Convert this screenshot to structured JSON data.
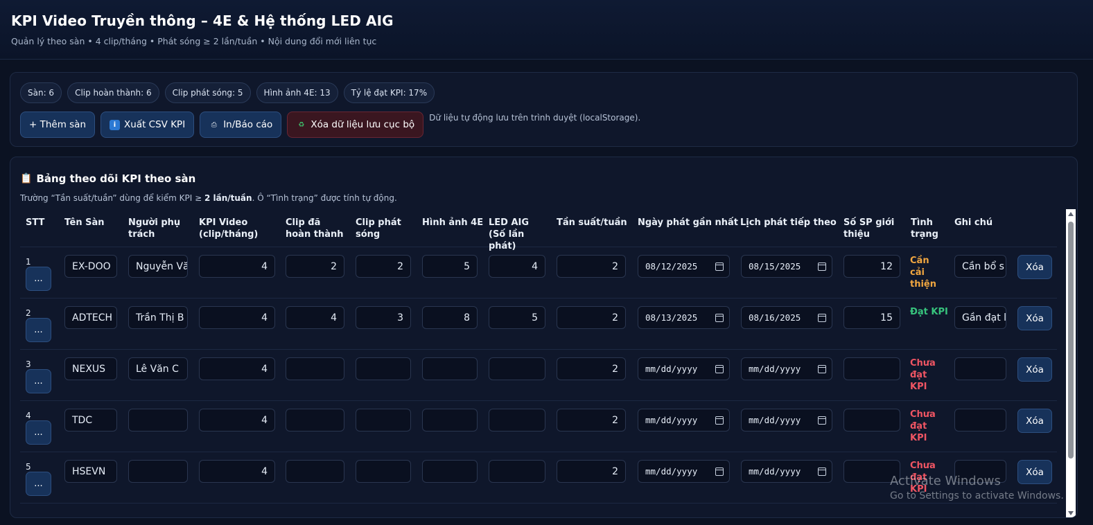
{
  "header": {
    "title": "KPI Video Truyền thông – 4E & Hệ thống LED AIG",
    "subtitle": "Quản lý theo sàn • 4 clip/tháng • Phát sóng ≥ 2 lần/tuần • Nội dung đổi mới liên tục"
  },
  "stats": {
    "chips": [
      "Sàn: 6",
      "Clip hoàn thành: 6",
      "Clip phát sóng: 5",
      "Hình ảnh 4E: 13",
      "Tỷ lệ đạt KPI: 17%"
    ]
  },
  "actions": {
    "add_label": "+ Thêm sàn",
    "export_label": "Xuất CSV KPI",
    "export_icon": "info-icon",
    "print_label": "In/Báo cáo",
    "print_icon": "printer-icon",
    "clear_label": "Xóa dữ liệu lưu cục bộ",
    "clear_icon": "recycle-icon",
    "note": "Dữ liệu tự động lưu trên trình duyệt (localStorage)."
  },
  "table": {
    "title": "Bảng theo dõi KPI theo sàn",
    "title_icon": "clipboard-icon",
    "desc_prefix": "Trường “Tần suất/tuần” dùng để kiểm KPI ≥ ",
    "desc_bold": "2 lần/tuần",
    "desc_suffix": ". Ô “Tình trạng” được tính tự động.",
    "headers": {
      "stt": "STT",
      "ten_san": "Tên Sàn",
      "nguoi_phu_trach": "Người phụ trách",
      "kpi_video": "KPI Video (clip/tháng)",
      "clip_hoan_thanh": "Clip đã hoàn thành",
      "clip_phat_song": "Clip phát sóng",
      "hinh_anh_4e": "Hình ảnh 4E",
      "led_aig": "LED AIG (Số lần phát)",
      "tan_suat": "Tần suất/tuần",
      "ngay_phat": "Ngày phát gần nhất",
      "lich_phat": "Lịch phát tiếp theo",
      "so_sp": "Số SP giới thiệu",
      "tinh_trang": "Tình trạng",
      "ghi_chu": "Ghi chú"
    },
    "menu_label": "...",
    "delete_label": "Xóa",
    "date_placeholder": "mm/dd/yyyy",
    "rows": [
      {
        "stt": "1",
        "ten_san": "EX-DOO",
        "nguoi": "Nguyễn Vă",
        "kpi": "4",
        "hoan_thanh": "2",
        "phat_song": "2",
        "hinh_anh": "5",
        "led": "4",
        "tan_suat": "2",
        "ngay_phat": "08/12/2025",
        "lich_phat": "08/15/2025",
        "so_sp": "12",
        "tinh_trang": "Cần cải thiện",
        "status": "warn",
        "ghi_chu": "Cần bổ s"
      },
      {
        "stt": "2",
        "ten_san": "ADTECH",
        "nguoi": "Trần Thị B",
        "kpi": "4",
        "hoan_thanh": "4",
        "phat_song": "3",
        "hinh_anh": "8",
        "led": "5",
        "tan_suat": "2",
        "ngay_phat": "08/13/2025",
        "lich_phat": "08/16/2025",
        "so_sp": "15",
        "tinh_trang": "Đạt KPI",
        "status": "ok",
        "ghi_chu": "Gần đạt l"
      },
      {
        "stt": "3",
        "ten_san": "NEXUS",
        "nguoi": "Lê Văn C",
        "kpi": "4",
        "hoan_thanh": "",
        "phat_song": "",
        "hinh_anh": "",
        "led": "",
        "tan_suat": "2",
        "ngay_phat": "",
        "lich_phat": "",
        "so_sp": "",
        "tinh_trang": "Chưa đạt KPI",
        "status": "bad",
        "ghi_chu": ""
      },
      {
        "stt": "4",
        "ten_san": "TDC",
        "nguoi": "",
        "kpi": "4",
        "hoan_thanh": "",
        "phat_song": "",
        "hinh_anh": "",
        "led": "",
        "tan_suat": "2",
        "ngay_phat": "",
        "lich_phat": "",
        "so_sp": "",
        "tinh_trang": "Chưa đạt KPI",
        "status": "bad",
        "ghi_chu": ""
      },
      {
        "stt": "5",
        "ten_san": "HSEVN",
        "nguoi": "",
        "kpi": "4",
        "hoan_thanh": "",
        "phat_song": "",
        "hinh_anh": "",
        "led": "",
        "tan_suat": "2",
        "ngay_phat": "",
        "lich_phat": "",
        "so_sp": "",
        "tinh_trang": "Chưa đạt KPI",
        "status": "bad",
        "ghi_chu": ""
      }
    ]
  },
  "watermark": {
    "line1": "Activate Windows",
    "line2": "Go to Settings to activate Windows."
  },
  "colors": {
    "background": "#0b1222",
    "panel": "#0f172b",
    "button": "#17325a",
    "status_warn": "#f0a640",
    "status_ok": "#37c47d",
    "status_bad": "#ef5563"
  }
}
